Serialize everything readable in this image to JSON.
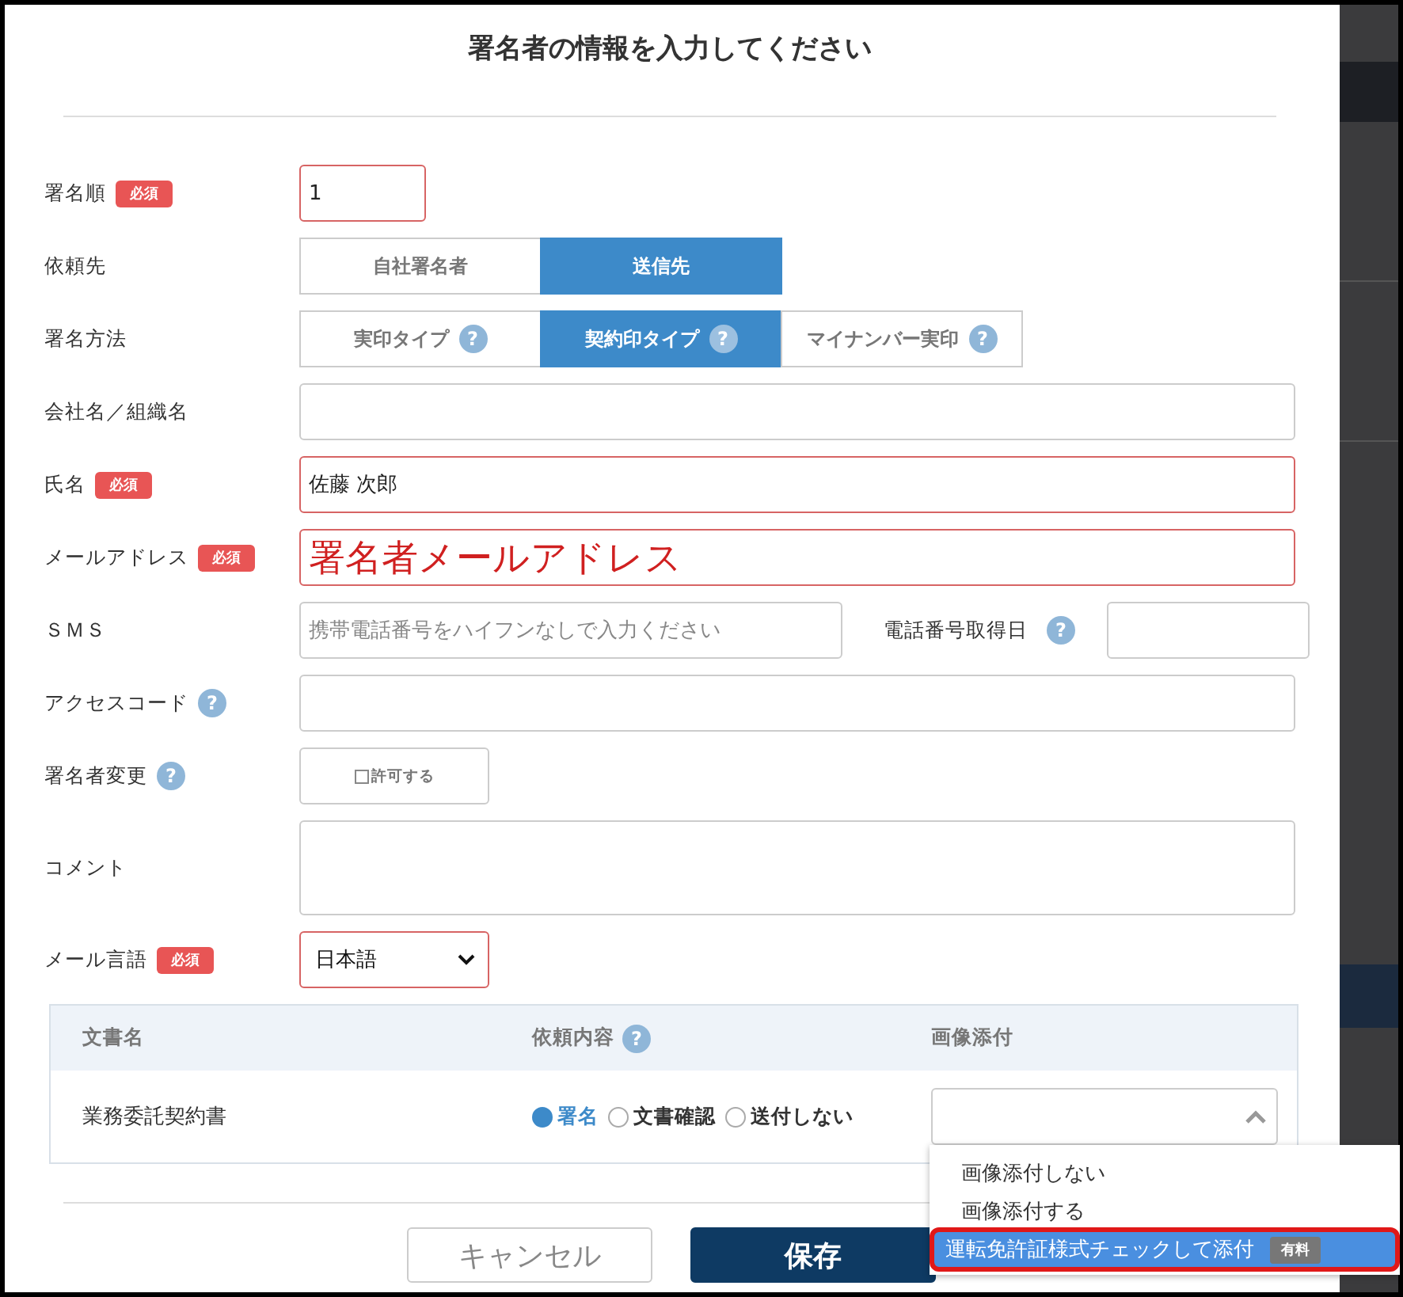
{
  "title": "署名者の情報を入力してください",
  "fields": [
    {
      "kind": "short_text",
      "label": "署名順",
      "badge": "必須",
      "value": "1"
    },
    {
      "kind": "segments",
      "label": "依頼先",
      "options": [
        {
          "label": "自社署名者",
          "selected": false
        },
        {
          "label": "送信先",
          "selected": true
        }
      ]
    },
    {
      "kind": "segments",
      "label": "署名方法",
      "options": [
        {
          "label": "実印タイプ",
          "selected": false,
          "help": "?"
        },
        {
          "label": "契約印タイプ",
          "selected": true,
          "help": "?"
        },
        {
          "label": "マイナンバー実印",
          "selected": false,
          "help": "?"
        }
      ]
    },
    {
      "kind": "text",
      "label": "会社名／組織名"
    },
    {
      "kind": "text",
      "label": "氏名",
      "badge": "必須",
      "value": "佐藤 次郎"
    },
    {
      "kind": "text",
      "label": "メールアドレス",
      "badge": "必須",
      "value": "署名者メールアドレス",
      "highlighted": true
    },
    {
      "kind": "phone",
      "label": "ＳＭＳ",
      "placeholder": "携帯電話番号をハイフンなしで入力ください",
      "extra_label": "電話番号取得日",
      "extra_help": "?"
    },
    {
      "kind": "text",
      "label": "アクセスコード",
      "help": "?"
    },
    {
      "kind": "checkbox_button",
      "label": "署名者変更",
      "help": "?",
      "option": {
        "label": "許可する",
        "checked": false
      }
    },
    {
      "kind": "textarea",
      "label": "コメント"
    },
    {
      "kind": "select",
      "label": "メール言語",
      "badge": "必須",
      "value": "日本語"
    }
  ],
  "table": {
    "columns": [
      {
        "label": "文書名"
      },
      {
        "label": "依頼内容",
        "help": "?"
      },
      {
        "label": "画像添付"
      }
    ],
    "rows": [
      {
        "name": "業務委託契約書",
        "options": [
          {
            "label": "署名",
            "selected": true
          },
          {
            "label": "文書確認",
            "selected": false
          },
          {
            "label": "送付しない",
            "selected": false
          }
        ],
        "attachment": {
          "expanded": true,
          "options": [
            {
              "label": "画像添付しない",
              "selected": false
            },
            {
              "label": "画像添付する",
              "selected": false
            },
            {
              "label": "運転免許証様式チェックして添付",
              "selected": true,
              "badge": "有料"
            }
          ]
        }
      }
    ]
  },
  "buttons": [
    {
      "label": "キャンセル",
      "kind": "secondary"
    },
    {
      "label": "保存",
      "kind": "primary"
    }
  ]
}
